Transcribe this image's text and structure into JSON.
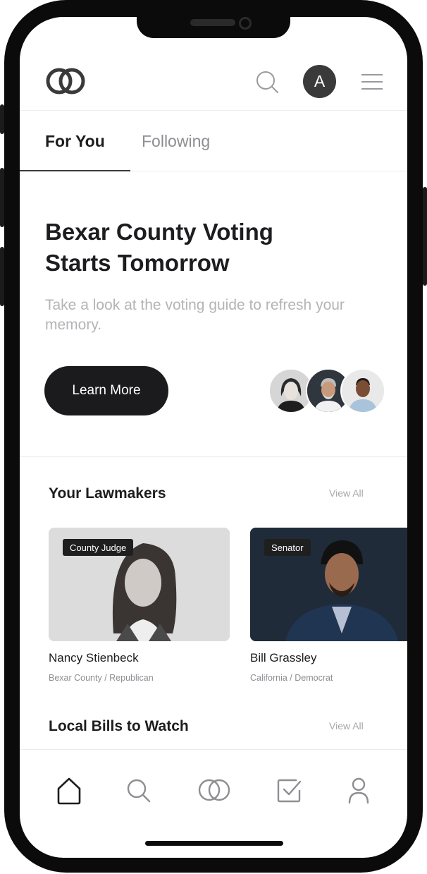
{
  "header": {
    "logo_icon": "interlocking-rings-logo",
    "search_icon": "search-icon",
    "avatar_initial": "A",
    "menu_icon": "hamburger-menu-icon"
  },
  "tabs": [
    {
      "label": "For You",
      "active": true
    },
    {
      "label": "Following",
      "active": false
    }
  ],
  "hero": {
    "title": "Bexar County Voting Starts Tomorrow",
    "subtitle": "Take a look at the voting guide to refresh your memory.",
    "button_label": "Learn More"
  },
  "lawmakers": {
    "title": "Your Lawmakers",
    "view_all": "View All",
    "cards": [
      {
        "badge": "County Judge",
        "name": "Nancy Stienbeck",
        "meta": "Bexar County / Republican"
      },
      {
        "badge": "Senator",
        "name": "Bill Grassley",
        "meta": "California / Democrat"
      }
    ]
  },
  "bills": {
    "title": "Local Bills to Watch",
    "view_all": "View All"
  },
  "bottom_nav": [
    "home-icon",
    "search-icon",
    "rings-icon",
    "checkbox-icon",
    "profile-icon"
  ],
  "colors": {
    "primary_dark": "#1b1b1d",
    "muted_text": "#b4b4b8",
    "divider": "#ececec"
  }
}
